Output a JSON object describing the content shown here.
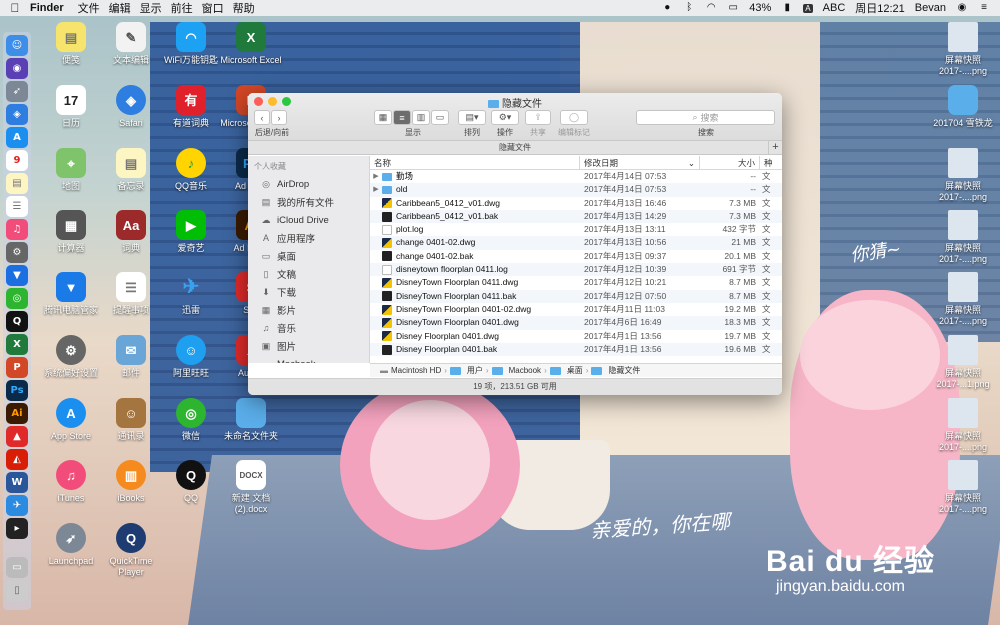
{
  "menubar": {
    "app": "Finder",
    "menus": [
      "文件",
      "编辑",
      "显示",
      "前往",
      "窗口",
      "帮助"
    ],
    "battery": "43%",
    "input_method": "ABC",
    "clock": "周日12:21",
    "user": "Bevan"
  },
  "desktop": {
    "col1": [
      "便笺",
      "日历",
      "地图",
      "计算器",
      "腾讯电脑管家",
      "系统偏好设置",
      "App Store",
      "iTunes",
      "Launchpad"
    ],
    "col2": [
      "文本编辑",
      "Safari",
      "备忘录",
      "词典",
      "提醒事项",
      "邮件",
      "通讯录",
      "iBooks",
      "QuickTime Player"
    ],
    "col3": [
      "WiFi万能钥匙",
      "有道词典",
      "QQ音乐",
      "爱奇艺",
      "迅雷",
      "阿里旺旺",
      "微信",
      "QQ"
    ],
    "col4": [
      "Microsoft Excel",
      "Microsoft Powe",
      "Ad Phot",
      "Ad Illustr",
      "Ske",
      "Auto 2",
      "未命名文件夹",
      "新建 文档 (2).docx"
    ],
    "right": [
      "屏幕快照 2017-....png",
      "201704 雪铁龙",
      "屏幕快照 2017-....png",
      "屏幕快照 2017-....png",
      "屏幕快照 2017-....png",
      "屏幕快照 2017-...1.png",
      "屏幕快照 2017-....png",
      "屏幕快照 2017-....png"
    ],
    "calendar_day": "17"
  },
  "finder": {
    "title": "隐藏文件",
    "toolbar": {
      "nav_label": "后退/向前",
      "view_label": "显示",
      "sort_label": "排列",
      "action_label": "操作",
      "share_label": "共享",
      "tag_label": "编辑标记",
      "search_placeholder": "搜索",
      "search_label": "搜索"
    },
    "tab_title": "隐藏文件",
    "sidebar": {
      "section": "个人收藏",
      "items": [
        {
          "label": "AirDrop",
          "icon": "airdrop-icon",
          "glyph": "◎"
        },
        {
          "label": "我的所有文件",
          "icon": "all-files-icon",
          "glyph": "▤"
        },
        {
          "label": "iCloud Drive",
          "icon": "cloud-icon",
          "glyph": "☁"
        },
        {
          "label": "应用程序",
          "icon": "applications-icon",
          "glyph": "A"
        },
        {
          "label": "桌面",
          "icon": "desktop-icon",
          "glyph": "▭"
        },
        {
          "label": "文稿",
          "icon": "documents-icon",
          "glyph": "▯"
        },
        {
          "label": "下载",
          "icon": "downloads-icon",
          "glyph": "⬇"
        },
        {
          "label": "影片",
          "icon": "movies-icon",
          "glyph": "▦"
        },
        {
          "label": "音乐",
          "icon": "music-icon",
          "glyph": "♫"
        },
        {
          "label": "图片",
          "icon": "pictures-icon",
          "glyph": "▣"
        },
        {
          "label": "Macbook",
          "icon": "disk-icon",
          "glyph": "▬"
        }
      ]
    },
    "columns": {
      "name": "名称",
      "date": "修改日期",
      "size": "大小",
      "kind": "种"
    },
    "files": [
      {
        "name": "勤场",
        "date": "2017年4月14日 07:53",
        "size": "--",
        "kind": "文",
        "type": "folder"
      },
      {
        "name": "old",
        "date": "2017年4月14日 07:53",
        "size": "--",
        "kind": "文",
        "type": "folder"
      },
      {
        "name": "Caribbean5_0412_v01.dwg",
        "date": "2017年4月13日 16:46",
        "size": "7.3 MB",
        "kind": "文",
        "type": "dwg"
      },
      {
        "name": "Caribbean5_0412_v01.bak",
        "date": "2017年4月13日 14:29",
        "size": "7.3 MB",
        "kind": "文",
        "type": "bak"
      },
      {
        "name": "plot.log",
        "date": "2017年4月13日 13:11",
        "size": "432 字节",
        "kind": "文",
        "type": "doc"
      },
      {
        "name": "change 0401-02.dwg",
        "date": "2017年4月13日 10:56",
        "size": "21 MB",
        "kind": "文",
        "type": "dwg"
      },
      {
        "name": "change 0401-02.bak",
        "date": "2017年4月13日 09:37",
        "size": "20.1 MB",
        "kind": "文",
        "type": "bak"
      },
      {
        "name": "disneytown floorplan 0411.log",
        "date": "2017年4月12日 10:39",
        "size": "691 字节",
        "kind": "文",
        "type": "doc"
      },
      {
        "name": "DisneyTown Floorplan 0411.dwg",
        "date": "2017年4月12日 10:21",
        "size": "8.7 MB",
        "kind": "文",
        "type": "dwg"
      },
      {
        "name": "DisneyTown Floorplan 0411.bak",
        "date": "2017年4月12日 07:50",
        "size": "8.7 MB",
        "kind": "文",
        "type": "bak"
      },
      {
        "name": "DisneyTown Floorplan 0401-02.dwg",
        "date": "2017年4月11日 11:03",
        "size": "19.2 MB",
        "kind": "文",
        "type": "dwg"
      },
      {
        "name": "DisneyTown Floorplan 0401.dwg",
        "date": "2017年4月6日 16:49",
        "size": "18.3 MB",
        "kind": "文",
        "type": "dwg"
      },
      {
        "name": "Disney Floorplan 0401.dwg",
        "date": "2017年4月1日 13:56",
        "size": "19.7 MB",
        "kind": "文",
        "type": "dwg"
      },
      {
        "name": "Disney Floorplan 0401.bak",
        "date": "2017年4月1日 13:56",
        "size": "19.6 MB",
        "kind": "文",
        "type": "bak"
      }
    ],
    "path": [
      "Macintosh HD",
      "用户",
      "Macbook",
      "桌面",
      "隐藏文件"
    ],
    "status": "19 项，213.51 GB 可用"
  },
  "watermark": {
    "line1": "Bai du 经验",
    "line2": "jingyan.baidu.com"
  },
  "handwriting": {
    "top": "你猜~",
    "bottom": "亲爱的，你在哪"
  }
}
